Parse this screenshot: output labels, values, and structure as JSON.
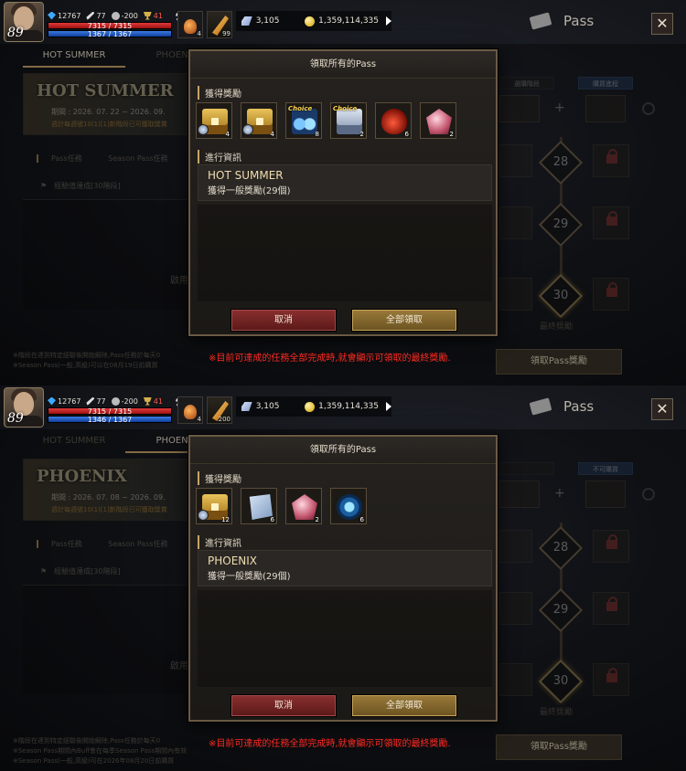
{
  "panels": [
    {
      "hud": {
        "level": "89",
        "gems": "12767",
        "attack": "77",
        "kills": "-200",
        "trophies": "41",
        "hp": "7315 / 7315",
        "mp": "1367 / 1367",
        "potion_count": "4",
        "feather_count": "99",
        "crystals": "3,105",
        "gold": "1,359,114,335"
      },
      "header": {
        "title": "Pass"
      },
      "tabs": [
        "HOT SUMMER",
        "PHOENIX"
      ],
      "event_card": {
        "name": "HOT SUMMER",
        "period": "期間 : 2026. 07. 22 ~ 2026. 09.",
        "reset": "週計每週號10(1)[1]新階段已可獲取獎賞"
      },
      "background": {
        "mission_tab": "Pass任務",
        "season_tab": "Season Pass任務",
        "exp_row": "經驗值達成[30階段]",
        "side_text": "啟用",
        "track_left_btn": "選購階段",
        "track_right_btn": "購買進程",
        "levels": [
          "28",
          "29",
          "30"
        ],
        "final_label": "最終獎勵",
        "claim_pass_label": "領取Pass獎勵",
        "notes": [
          "※階段在達到特定經驗後開始解除,Pass任務於每天0",
          "※Season Pass(一般,高級)可以在08月19日前購買"
        ]
      },
      "warning": "※目前可達成的任務全部完成時,就會顯示可領取的最終獎勵.",
      "dialog": {
        "title": "領取所有的Pass",
        "rewards_label": "獲得獎勵",
        "info_label": "進行資訊",
        "rewards": [
          {
            "icon": "gold-chest",
            "qty": "4",
            "choice": ""
          },
          {
            "icon": "gold-chest",
            "qty": "4",
            "choice": ""
          },
          {
            "icon": "blue-orbs",
            "qty": "8",
            "choice": "Choice"
          },
          {
            "icon": "silver-chest",
            "qty": "2",
            "choice": "Choice"
          },
          {
            "icon": "red-potion",
            "qty": "6",
            "choice": ""
          },
          {
            "icon": "pink-gem",
            "qty": "2",
            "choice": ""
          }
        ],
        "event_name": "HOT SUMMER",
        "event_desc": "獲得一般獎勵(29個)",
        "cancel": "取消",
        "confirm": "全部領取"
      }
    },
    {
      "hud": {
        "level": "89",
        "gems": "12767",
        "attack": "77",
        "kills": "-200",
        "trophies": "41",
        "hp": "7315 / 7315",
        "mp": "1346 / 1367",
        "potion_count": "4",
        "feather_count": "200",
        "crystals": "3,105",
        "gold": "1,359,114,335"
      },
      "header": {
        "title": "Pass"
      },
      "tabs": [
        "HOT SUMMER",
        "PHOENIX"
      ],
      "event_card": {
        "name": "PHOENIX",
        "period": "期間 : 2026. 07. 08 ~ 2026. 09.",
        "reset": "週計每週號10(1)[1]新階段已可獲取獎賞"
      },
      "background": {
        "mission_tab": "Pass任務",
        "season_tab": "Season Pass任務",
        "exp_row": "經驗值達成[30階段]",
        "side_text": "啟用",
        "track_left_btn": "",
        "track_right_btn": "不可購買",
        "levels": [
          "28",
          "29",
          "30"
        ],
        "final_label": "最終獎勵",
        "claim_pass_label": "領取Pass獎勵",
        "notes": [
          "※階段在達到特定經驗後開始解除,Pass任務於每天0",
          "※Season Pass期間內Buff會在每季Season Pass期間內有效",
          "※Season Pass(一般,高級)可在2026年08月20日前購買"
        ]
      },
      "warning": "※目前可達成的任務全部完成時,就會顯示可領取的最終獎勵.",
      "dialog": {
        "title": "領取所有的Pass",
        "rewards_label": "獲得獎勵",
        "info_label": "進行資訊",
        "rewards": [
          {
            "icon": "gold-chest",
            "qty": "12",
            "choice": ""
          },
          {
            "icon": "silver-scroll",
            "qty": "6",
            "choice": ""
          },
          {
            "icon": "pink-gem",
            "qty": "2",
            "choice": ""
          },
          {
            "icon": "blue-gem",
            "qty": "6",
            "choice": ""
          }
        ],
        "event_name": "PHOENIX",
        "event_desc": "獲得一般獎勵(29個)",
        "cancel": "取消",
        "confirm": "全部領取"
      }
    }
  ]
}
